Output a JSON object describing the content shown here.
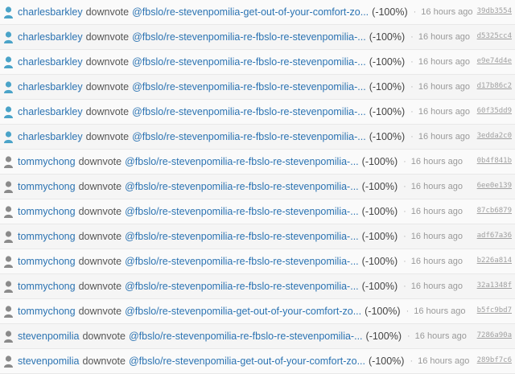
{
  "colors": {
    "link": "#2b73b2",
    "row_bg": "#fafafa",
    "row_alt_bg": "#f5f5f5",
    "border": "#e8e8e8",
    "avatar_blue": "#4aa3c8",
    "avatar_gray": "#8a8a8a"
  },
  "icons": {
    "charlesbarkley": "blue-avatar-icon",
    "tommychong": "gray-avatar-icon",
    "stevenpomilia": "gray-avatar-icon"
  },
  "rows": [
    {
      "user": "charlesbarkley",
      "verb": "downvote",
      "link": "@fbslo/re-stevenpomilia-get-out-of-your-comfort-zo...",
      "pct": "(-100%)",
      "dot": "·",
      "time": "16 hours ago",
      "hash": "39db3554",
      "avatar": "blue"
    },
    {
      "user": "charlesbarkley",
      "verb": "downvote",
      "link": "@fbslo/re-stevenpomilia-re-fbslo-re-stevenpomilia-...",
      "pct": "(-100%)",
      "dot": "·",
      "time": "16 hours ago",
      "hash": "d5325cc4",
      "avatar": "blue"
    },
    {
      "user": "charlesbarkley",
      "verb": "downvote",
      "link": "@fbslo/re-stevenpomilia-re-fbslo-re-stevenpomilia-...",
      "pct": "(-100%)",
      "dot": "·",
      "time": "16 hours ago",
      "hash": "e9e74d4e",
      "avatar": "blue"
    },
    {
      "user": "charlesbarkley",
      "verb": "downvote",
      "link": "@fbslo/re-stevenpomilia-re-fbslo-re-stevenpomilia-...",
      "pct": "(-100%)",
      "dot": "·",
      "time": "16 hours ago",
      "hash": "d17b86c2",
      "avatar": "blue"
    },
    {
      "user": "charlesbarkley",
      "verb": "downvote",
      "link": "@fbslo/re-stevenpomilia-re-fbslo-re-stevenpomilia-...",
      "pct": "(-100%)",
      "dot": "·",
      "time": "16 hours ago",
      "hash": "60f35dd9",
      "avatar": "blue"
    },
    {
      "user": "charlesbarkley",
      "verb": "downvote",
      "link": "@fbslo/re-stevenpomilia-re-fbslo-re-stevenpomilia-...",
      "pct": "(-100%)",
      "dot": "·",
      "time": "16 hours ago",
      "hash": "3edda2c0",
      "avatar": "blue"
    },
    {
      "user": "tommychong",
      "verb": "downvote",
      "link": "@fbslo/re-stevenpomilia-re-fbslo-re-stevenpomilia-...",
      "pct": "(-100%)",
      "dot": "·",
      "time": "16 hours ago",
      "hash": "0b4f841b",
      "avatar": "gray"
    },
    {
      "user": "tommychong",
      "verb": "downvote",
      "link": "@fbslo/re-stevenpomilia-re-fbslo-re-stevenpomilia-...",
      "pct": "(-100%)",
      "dot": "·",
      "time": "16 hours ago",
      "hash": "6ee0e139",
      "avatar": "gray"
    },
    {
      "user": "tommychong",
      "verb": "downvote",
      "link": "@fbslo/re-stevenpomilia-re-fbslo-re-stevenpomilia-...",
      "pct": "(-100%)",
      "dot": "·",
      "time": "16 hours ago",
      "hash": "87cb6879",
      "avatar": "gray"
    },
    {
      "user": "tommychong",
      "verb": "downvote",
      "link": "@fbslo/re-stevenpomilia-re-fbslo-re-stevenpomilia-...",
      "pct": "(-100%)",
      "dot": "·",
      "time": "16 hours ago",
      "hash": "adf67a36",
      "avatar": "gray"
    },
    {
      "user": "tommychong",
      "verb": "downvote",
      "link": "@fbslo/re-stevenpomilia-re-fbslo-re-stevenpomilia-...",
      "pct": "(-100%)",
      "dot": "·",
      "time": "16 hours ago",
      "hash": "b226a814",
      "avatar": "gray"
    },
    {
      "user": "tommychong",
      "verb": "downvote",
      "link": "@fbslo/re-stevenpomilia-re-fbslo-re-stevenpomilia-...",
      "pct": "(-100%)",
      "dot": "·",
      "time": "16 hours ago",
      "hash": "32a1348f",
      "avatar": "gray"
    },
    {
      "user": "tommychong",
      "verb": "downvote",
      "link": "@fbslo/re-stevenpomilia-get-out-of-your-comfort-zo...",
      "pct": "(-100%)",
      "dot": "·",
      "time": "16 hours ago",
      "hash": "b5fc9bd7",
      "avatar": "gray"
    },
    {
      "user": "stevenpomilia",
      "verb": "downvote",
      "link": "@fbslo/re-stevenpomilia-re-fbslo-re-stevenpomilia-...",
      "pct": "(-100%)",
      "dot": "·",
      "time": "16 hours ago",
      "hash": "7286a90a",
      "avatar": "gray"
    },
    {
      "user": "stevenpomilia",
      "verb": "downvote",
      "link": "@fbslo/re-stevenpomilia-get-out-of-your-comfort-zo...",
      "pct": "(-100%)",
      "dot": "·",
      "time": "16 hours ago",
      "hash": "289bf7c6",
      "avatar": "gray"
    }
  ]
}
